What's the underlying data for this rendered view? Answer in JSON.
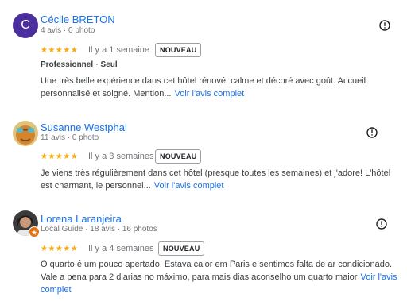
{
  "reviews": [
    {
      "name": "Cécile BRETON",
      "avatar_letter": "C",
      "meta": "4 avis · 0 photo",
      "stars": "★★★★★",
      "time": "Il y a 1 semaine",
      "badge": "NOUVEAU",
      "tag_1": "Professionnel",
      "tag_sep": "·",
      "tag_2": "Seul",
      "text": "Une très belle expérience dans cet hôtel rénové, calme et décoré avec goût. Accueil personnalisé et soigné. Mention...",
      "more_link": "Voir l'avis complet",
      "more_icon": "info-circle-icon"
    },
    {
      "name": "Susanne Westphal",
      "meta": "11 avis · 0 photo",
      "stars": "★★★★★",
      "time": "Il y a 3 semaines",
      "badge": "NOUVEAU",
      "text": "Je viens très régulièrement dans cet hôtel (presque toutes les semaines) et j'adore! L'hôtel est charmant, le personnel...",
      "more_link": "Voir l'avis complet",
      "more_icon": "info-circle-icon"
    },
    {
      "name": "Lorena Laranjeira",
      "meta": "Local Guide · 18 avis · 16 photos",
      "stars": "★★★★★",
      "time": "Il y a 4 semaines",
      "badge": "NOUVEAU",
      "text": "O quarto é um pouco apertado. Estava calor em Paris e sentimos falta de ar condicionado. Vale a pena para 2 diarias no máximo, para mais dias aconselho um quarto maior",
      "more_link": "Voir l'avis complet",
      "more_icon": "info-circle-icon"
    }
  ],
  "colors": {
    "link": "#1a73e8",
    "star": "#f9ab00",
    "avatar_1": "#4b2f9f",
    "text": "#3c4043",
    "meta": "#70757a"
  },
  "rating": {
    "max_stars": 5,
    "review_1_stars": 5,
    "review_2_stars": 5,
    "review_3_stars": 5
  }
}
